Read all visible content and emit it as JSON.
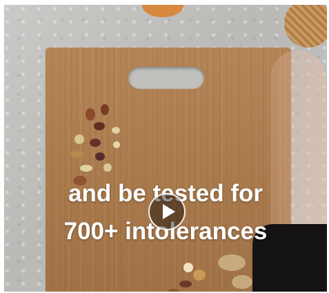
{
  "video": {
    "caption_line1": "and be tested for",
    "caption_line2": "700+ intolerances",
    "play_button": "play-icon",
    "colors": {
      "board": "#a97a4c",
      "background": "#c3c3c0",
      "caption_text": "#ffffff",
      "play_overlay": "#00000066"
    }
  }
}
